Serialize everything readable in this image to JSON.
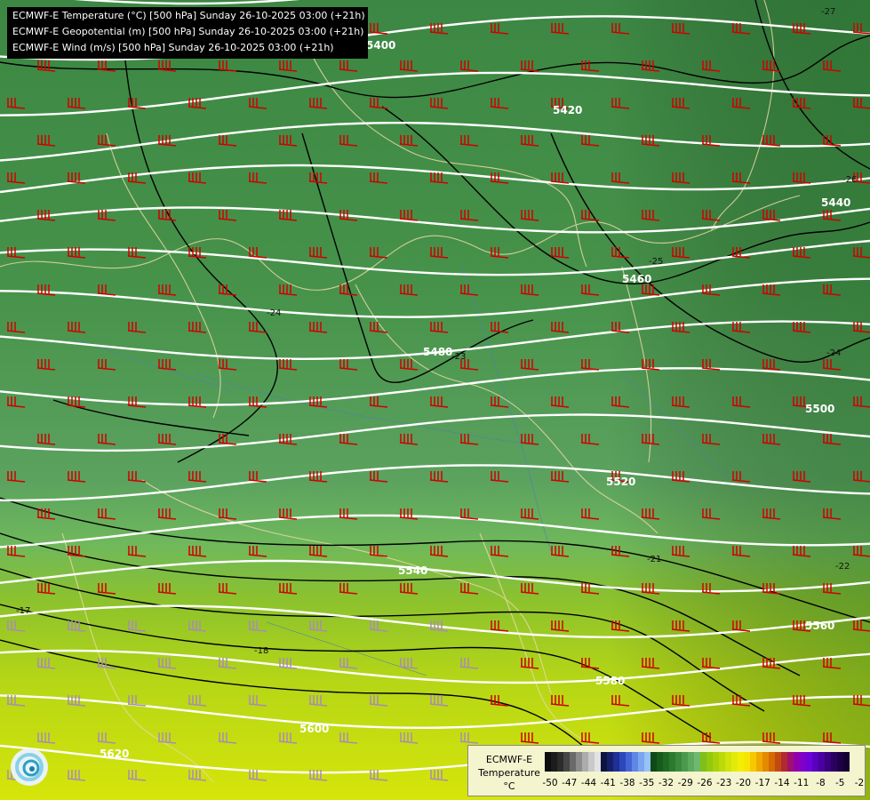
{
  "title_lines": [
    "ECMWF-E Temperature (°C) [500 hPa] Sunday 26-10-2025 03:00 (+21h)",
    "ECMWF-E Geopotential (m) [500 hPa] Sunday 26-10-2025 03:00 (+21h)",
    "ECMWF-E Wind (m/s) [500 hPa] Sunday 26-10-2025 03:00 (+21h)"
  ],
  "geopotential_labels": [
    "5400",
    "5420",
    "5440",
    "5460",
    "5480",
    "5500",
    "5520",
    "5540",
    "5560",
    "5580",
    "5600",
    "5620"
  ],
  "temperature_labels": [
    "-27",
    "-26",
    "-25",
    "-24",
    "-24",
    "-23",
    "-22",
    "-21",
    "-17",
    "-18"
  ],
  "legend": {
    "title_line1": "ECMWF-E",
    "title_line2": "Temperature",
    "title_line3": "°C",
    "tick_labels": [
      "-50",
      "-47",
      "-44",
      "-41",
      "-38",
      "-35",
      "-32",
      "-29",
      "-26",
      "-23",
      "-20",
      "-17",
      "-14",
      "-11",
      "-8",
      "-5",
      "-2"
    ],
    "colors": [
      "#0d0d0d",
      "#1c1c1c",
      "#2c2c2c",
      "#464646",
      "#6a6a6a",
      "#8c8c8c",
      "#acacac",
      "#c9c9c9",
      "#e2e2e2",
      "#0d1440",
      "#16206a",
      "#1e2f95",
      "#2c46bb",
      "#4364d6",
      "#5f87e6",
      "#7aa6ef",
      "#96c3f5",
      "#0f4a16",
      "#165a1c",
      "#1f6a23",
      "#2b7a2e",
      "#3a8a3d",
      "#4a9a4e",
      "#5caa5d",
      "#6eb96e",
      "#7fbf1a",
      "#93c90c",
      "#a8d10a",
      "#bcd90a",
      "#d0e30a",
      "#e2ea08",
      "#f2ee05",
      "#f7e400",
      "#f6c800",
      "#f0a800",
      "#e48a00",
      "#d46a00",
      "#c24a10",
      "#b02a30",
      "#a01070",
      "#9000b0",
      "#8000c8",
      "#7000d8",
      "#5a00c0",
      "#4a00a0",
      "#3a0080",
      "#2a0060",
      "#1e0046",
      "#140030"
    ]
  },
  "colors": {
    "background_green": "#3f8a45",
    "barb_red": "#d00000",
    "barb_grey": "#a98ab8",
    "isohypse": "#ffffff",
    "isotherm": "#000000",
    "border": "#e8d9a6"
  }
}
